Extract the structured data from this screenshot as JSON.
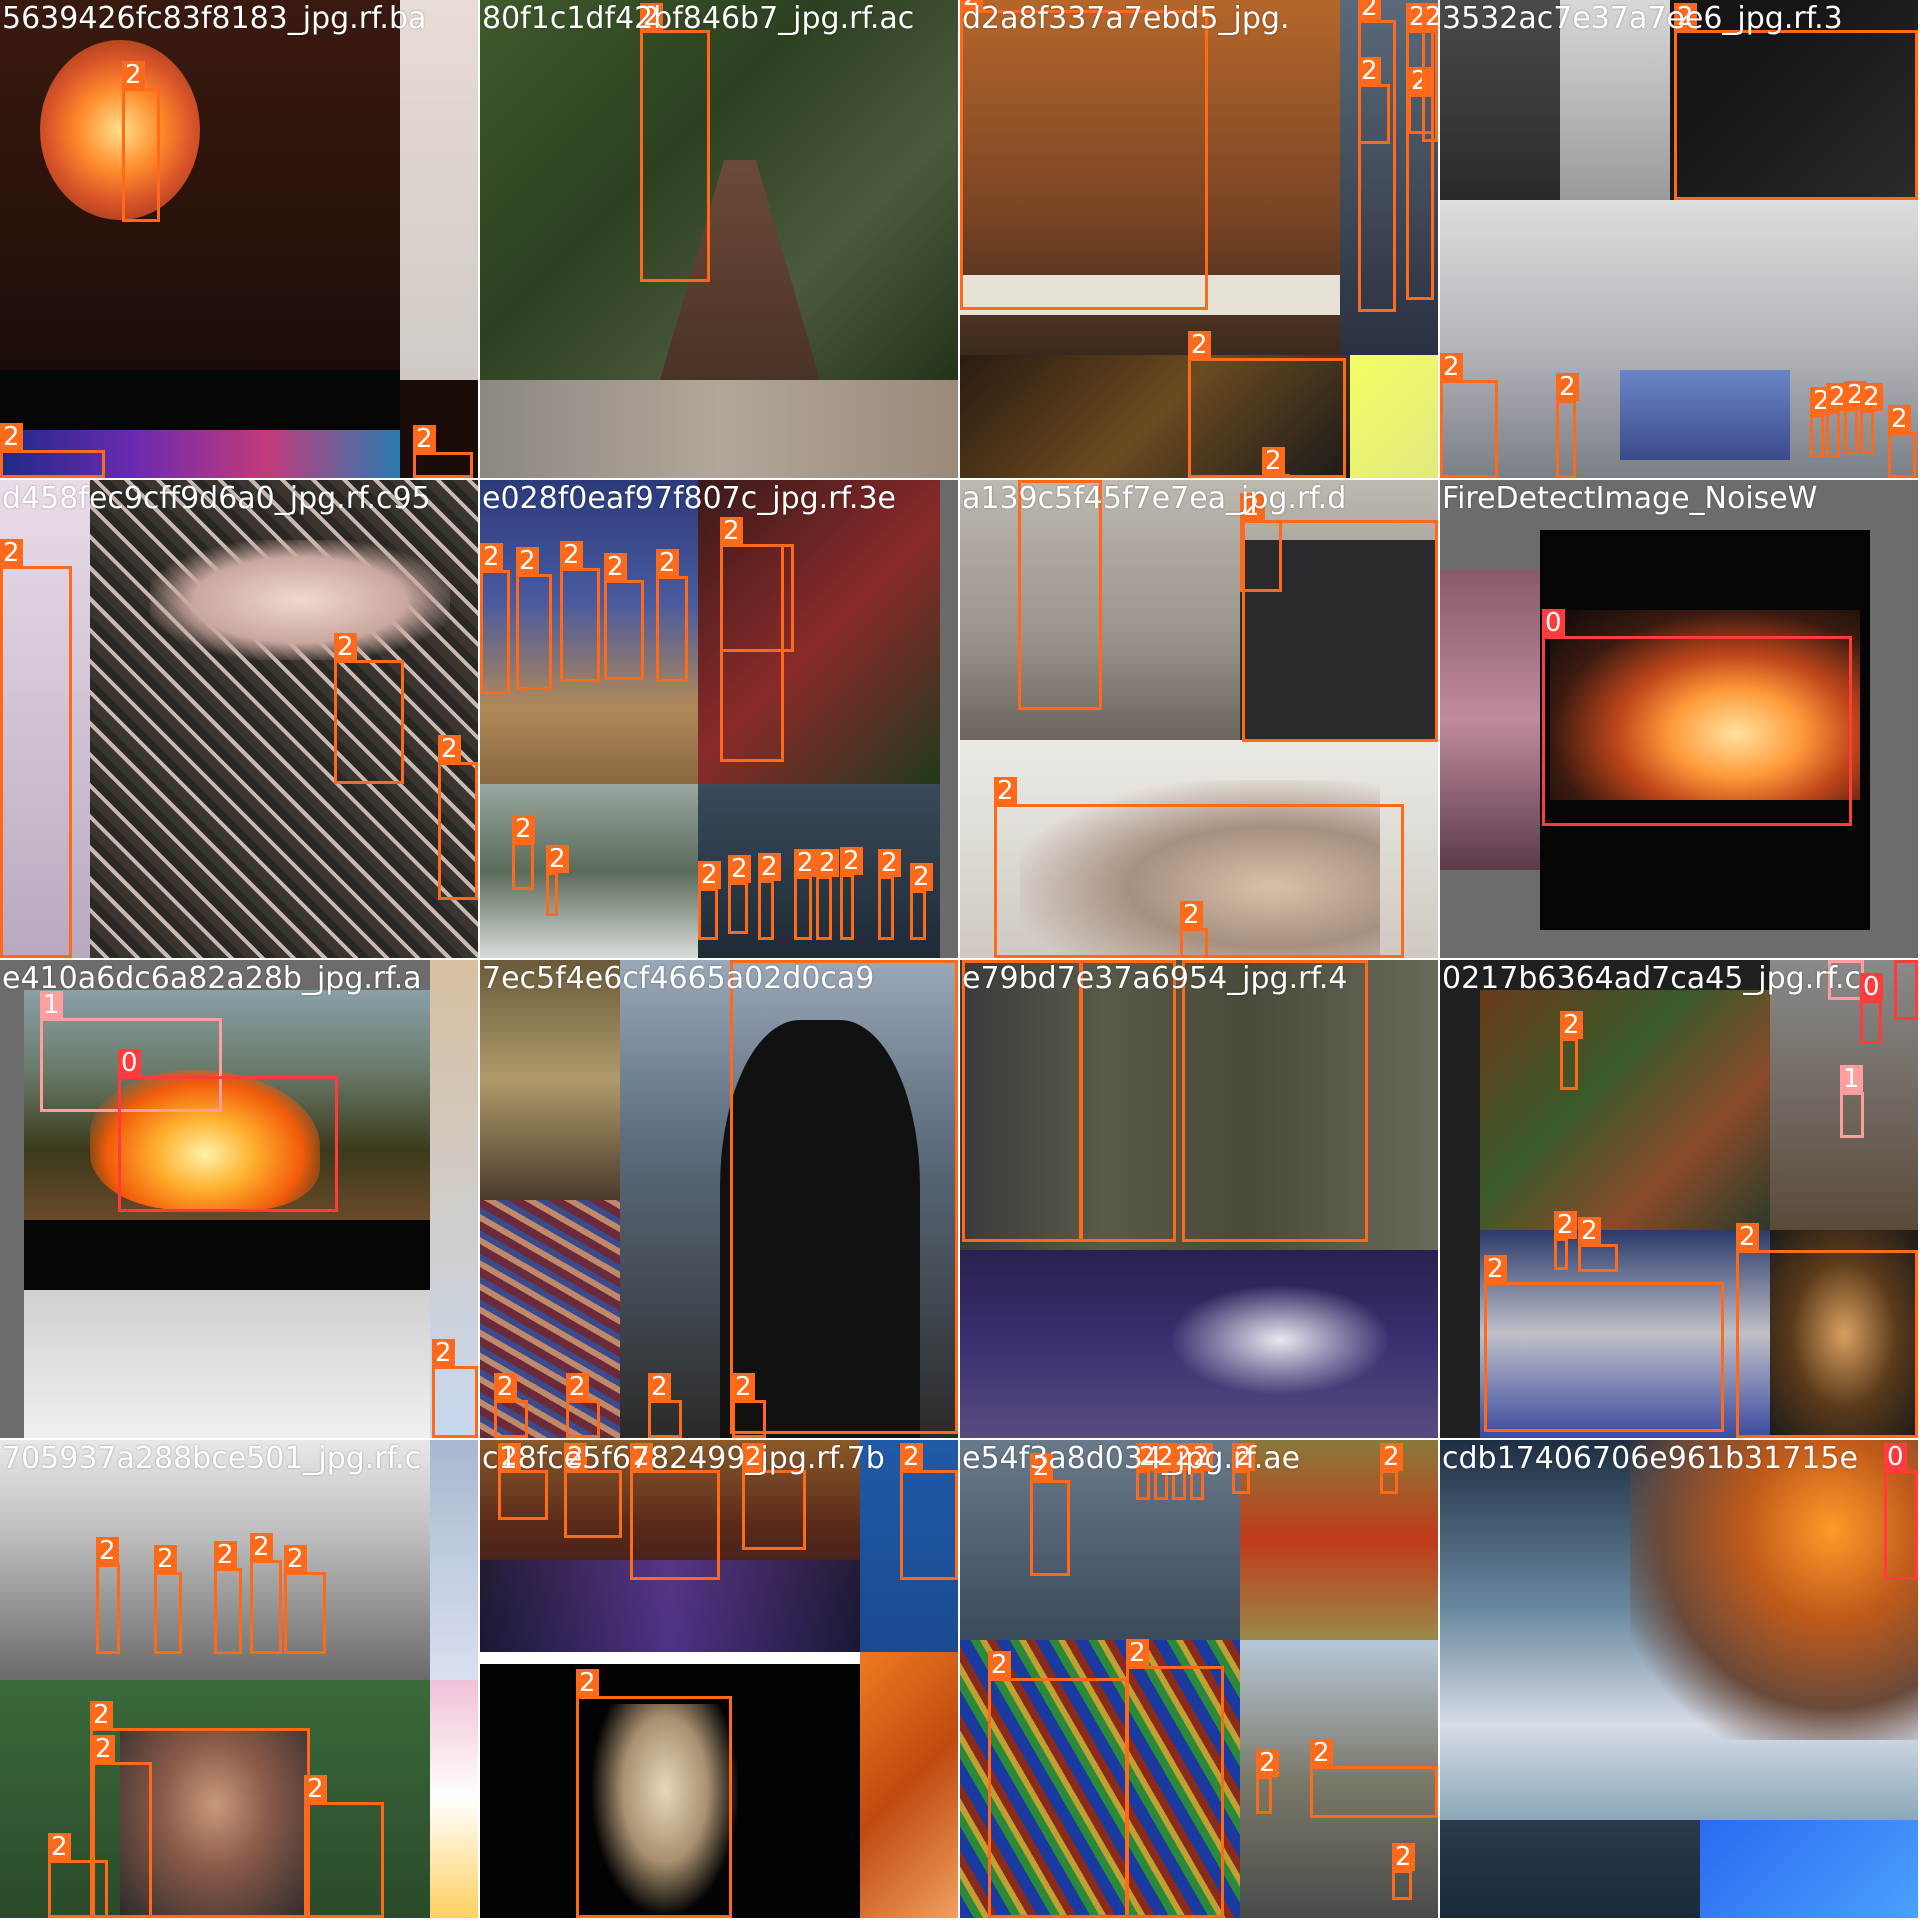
{
  "tiles": [
    {
      "label": "5639426fc83f8183_jpg.rf.ba",
      "boxes": [
        "2",
        "2",
        "2"
      ]
    },
    {
      "label": "80f1c1df42bf846b7_jpg.rf.ac",
      "boxes": [
        "2"
      ]
    },
    {
      "label": "d2a8f337a7ebd5_jpg.",
      "boxes": [
        "2",
        "2",
        "2",
        "2",
        "2",
        "2",
        "2",
        "2"
      ]
    },
    {
      "label": "3532ac7e37a7ee6_jpg.rf.3",
      "boxes": [
        "2",
        "2",
        "2",
        "2",
        "2",
        "2",
        "2",
        "2"
      ]
    },
    {
      "label": "d458fec9cff9d6a0_jpg.rf.c95",
      "boxes": [
        "2",
        "2",
        "2"
      ]
    },
    {
      "label": "e028f0eaf97f807c_jpg.rf.3e",
      "boxes": [
        "2",
        "2",
        "2",
        "2",
        "2",
        "2",
        "2",
        "2",
        "2",
        "2",
        "2",
        "2",
        "2",
        "2",
        "2",
        "2",
        "2"
      ]
    },
    {
      "label": "a139c5f45f7e7ea_jpg.rf.d",
      "boxes": [
        "2",
        "2",
        "2",
        "2",
        "2"
      ]
    },
    {
      "label": "FireDetectImage_NoiseW",
      "boxes": [
        "0"
      ]
    },
    {
      "label": "e410a6dc6a82a28b_jpg.rf.a",
      "boxes": [
        "1",
        "0",
        "2"
      ]
    },
    {
      "label": "7ec5f4e6cf4665a02d0ca9",
      "boxes": [
        "2",
        "2",
        "2",
        "2",
        "2"
      ]
    },
    {
      "label": "e79bd7e37a6954_jpg.rf.4",
      "boxes": [
        "2",
        "2",
        "2"
      ]
    },
    {
      "label": "0217b6364ad7ca45_jpg.rf.c",
      "boxes": [
        "1",
        "0",
        "0",
        "1",
        "2",
        "2",
        "2",
        "2",
        "2"
      ]
    },
    {
      "label": "705937a288bce501_jpg.rf.c",
      "boxes": [
        "2",
        "2",
        "2",
        "2",
        "2",
        "2",
        "2",
        "2",
        "2"
      ]
    },
    {
      "label": "c18fce5f6782499_jpg.rf.7b",
      "boxes": [
        "2",
        "2",
        "2",
        "2",
        "2",
        "2"
      ]
    },
    {
      "label": "e54f3a8d034_jpg.rf.ae",
      "boxes": [
        "2",
        "2",
        "2",
        "2",
        "2",
        "2",
        "2",
        "2",
        "2",
        "2",
        "2",
        "2"
      ]
    },
    {
      "label": "cdb17406706e961b31715e",
      "boxes": [
        "0"
      ]
    }
  ]
}
